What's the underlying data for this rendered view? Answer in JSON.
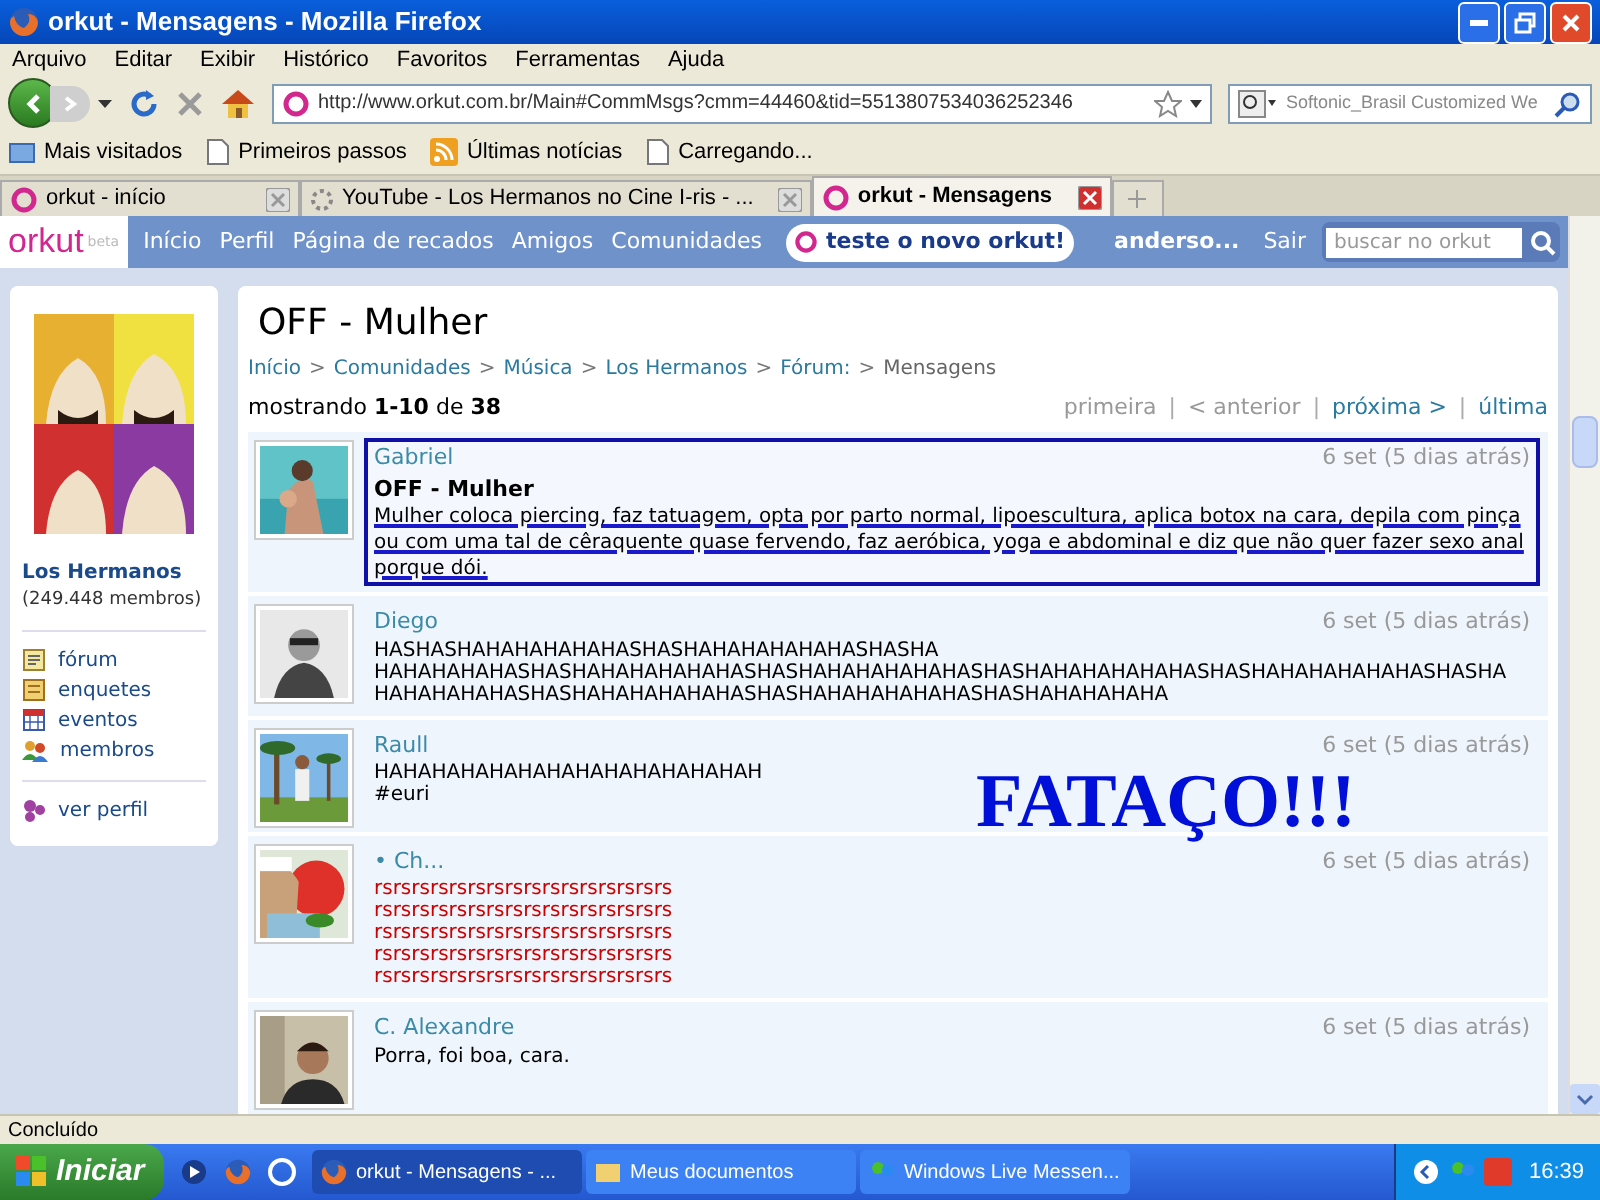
{
  "window": {
    "title": "orkut - Mensagens - Mozilla Firefox"
  },
  "menu": [
    "Arquivo",
    "Editar",
    "Exibir",
    "Histórico",
    "Favoritos",
    "Ferramentas",
    "Ajuda"
  ],
  "toolbar": {
    "url": "http://www.orkut.com.br/Main#CommMsgs?cmm=44460&tid=5513807534036252346",
    "search_placeholder": "Softonic_Brasil Customized We"
  },
  "bookmarks": [
    {
      "label": "Mais visitados",
      "kind": "folder"
    },
    {
      "label": "Primeiros passos",
      "kind": "page"
    },
    {
      "label": "Últimas notícias",
      "kind": "feed"
    },
    {
      "label": "Carregando...",
      "kind": "page"
    }
  ],
  "tabs": [
    {
      "label": "orkut - início",
      "selected": false,
      "kind": "orkut"
    },
    {
      "label": "YouTube - Los Hermanos no Cine I-ris - ...",
      "selected": false,
      "kind": "loading"
    },
    {
      "label": "orkut - Mensagens",
      "selected": true,
      "kind": "orkut"
    }
  ],
  "orkut_nav": {
    "logo": "orkut",
    "beta": "beta",
    "links": [
      "Início",
      "Perfil",
      "Página de recados",
      "Amigos",
      "Comunidades"
    ],
    "promo": "teste o novo orkut!",
    "user": "anderso...",
    "logout": "Sair",
    "search_placeholder": "buscar no orkut"
  },
  "sidebar": {
    "community": "Los Hermanos",
    "members": "(249.448 membros)",
    "links": [
      {
        "label": "fórum",
        "kind": "forum"
      },
      {
        "label": "enquetes",
        "kind": "poll"
      },
      {
        "label": "eventos",
        "kind": "calendar"
      },
      {
        "label": "membros",
        "kind": "members"
      }
    ],
    "profile_link": "ver perfil"
  },
  "page": {
    "title": "OFF - Mulher",
    "breadcrumb": {
      "separator": ">",
      "items": [
        {
          "label": "Início",
          "link": true
        },
        {
          "label": "Comunidades",
          "link": true
        },
        {
          "label": "Música",
          "link": true
        },
        {
          "label": "Los Hermanos",
          "link": true
        },
        {
          "label": "Fórum:",
          "link": true
        },
        {
          "label": "Mensagens",
          "link": false
        }
      ]
    },
    "showing": "mostrando **1-10** de **38**",
    "pager": {
      "separator": "|",
      "items": [
        {
          "label": "primeira",
          "disabled": true
        },
        {
          "label": "< anterior",
          "disabled": true
        },
        {
          "label": "próxima >",
          "disabled": false
        },
        {
          "label": "última",
          "disabled": false
        }
      ]
    }
  },
  "messages": [
    {
      "author": "Gabriel",
      "date": "6 set (5 dias atrás)",
      "subject": "OFF - Mulher",
      "highlighted": true,
      "underlined": true,
      "color": "#000000",
      "lines": [
        "Mulher coloca piercing, faz tatuagem, opta por parto normal, lipoescultura, aplica botox na cara, depila com pinça ou com uma tal de cêraquente quase fervendo, faz aeróbica, yoga e abdominal e diz que não quer fazer sexo anal porque dói."
      ]
    },
    {
      "author": "Diego",
      "date": "6 set (5 dias atrás)",
      "highlighted": false,
      "underlined": false,
      "color": "#000000",
      "lines": [
        "HASHASHAHAHAHAHAHASHASHAHAHAHAHAHASHASHA",
        "HAHAHAHAHASHASHAHAHAHAHAHASHASHAHAHAHAHAHASHASHAHAHAHAHAHASHASHAHAHAHAHAHASHASHA",
        "HAHAHAHAHASHASHAHAHAHAHAHASHASHAHAHAHAHAHASHASHAHAHAHAHA"
      ]
    },
    {
      "author": "Raull",
      "date": "6 set (5 dias atrás)",
      "highlighted": false,
      "underlined": false,
      "color": "#000000",
      "lines": [
        "HAHAHAHAHAHAHAHAHAHAHAHAHAH",
        "#euri"
      ],
      "annotation": "FATAÇO!!!"
    },
    {
      "author": "• Ch...",
      "date": "6 set (5 dias atrás)",
      "highlighted": false,
      "underlined": false,
      "color": "#cc0000",
      "lines": [
        "rsrsrsrsrsrsrsrsrsrsrsrsrsrsrsrs",
        "rsrsrsrsrsrsrsrsrsrsrsrsrsrsrsrs",
        "rsrsrsrsrsrsrsrsrsrsrsrsrsrsrsrs",
        "rsrsrsrsrsrsrsrsrsrsrsrsrsrsrsrs",
        "rsrsrsrsrsrsrsrsrsrsrsrsrsrsrsrs"
      ]
    },
    {
      "author": "C. Alexandre",
      "date": "6 set (5 dias atrás)",
      "highlighted": false,
      "underlined": false,
      "color": "#000000",
      "lines": [
        "Porra, foi boa, cara."
      ]
    }
  ],
  "status_bar": "Concluído",
  "taskbar": {
    "start": "Iniciar",
    "windows": [
      {
        "label": "orkut - Mensagens - ...",
        "selected": true,
        "kind": "firefox"
      },
      {
        "label": "Meus documentos",
        "selected": false,
        "kind": "folder"
      },
      {
        "label": "Windows Live Messen...",
        "selected": false,
        "kind": "messenger"
      }
    ],
    "clock": "16:39"
  }
}
